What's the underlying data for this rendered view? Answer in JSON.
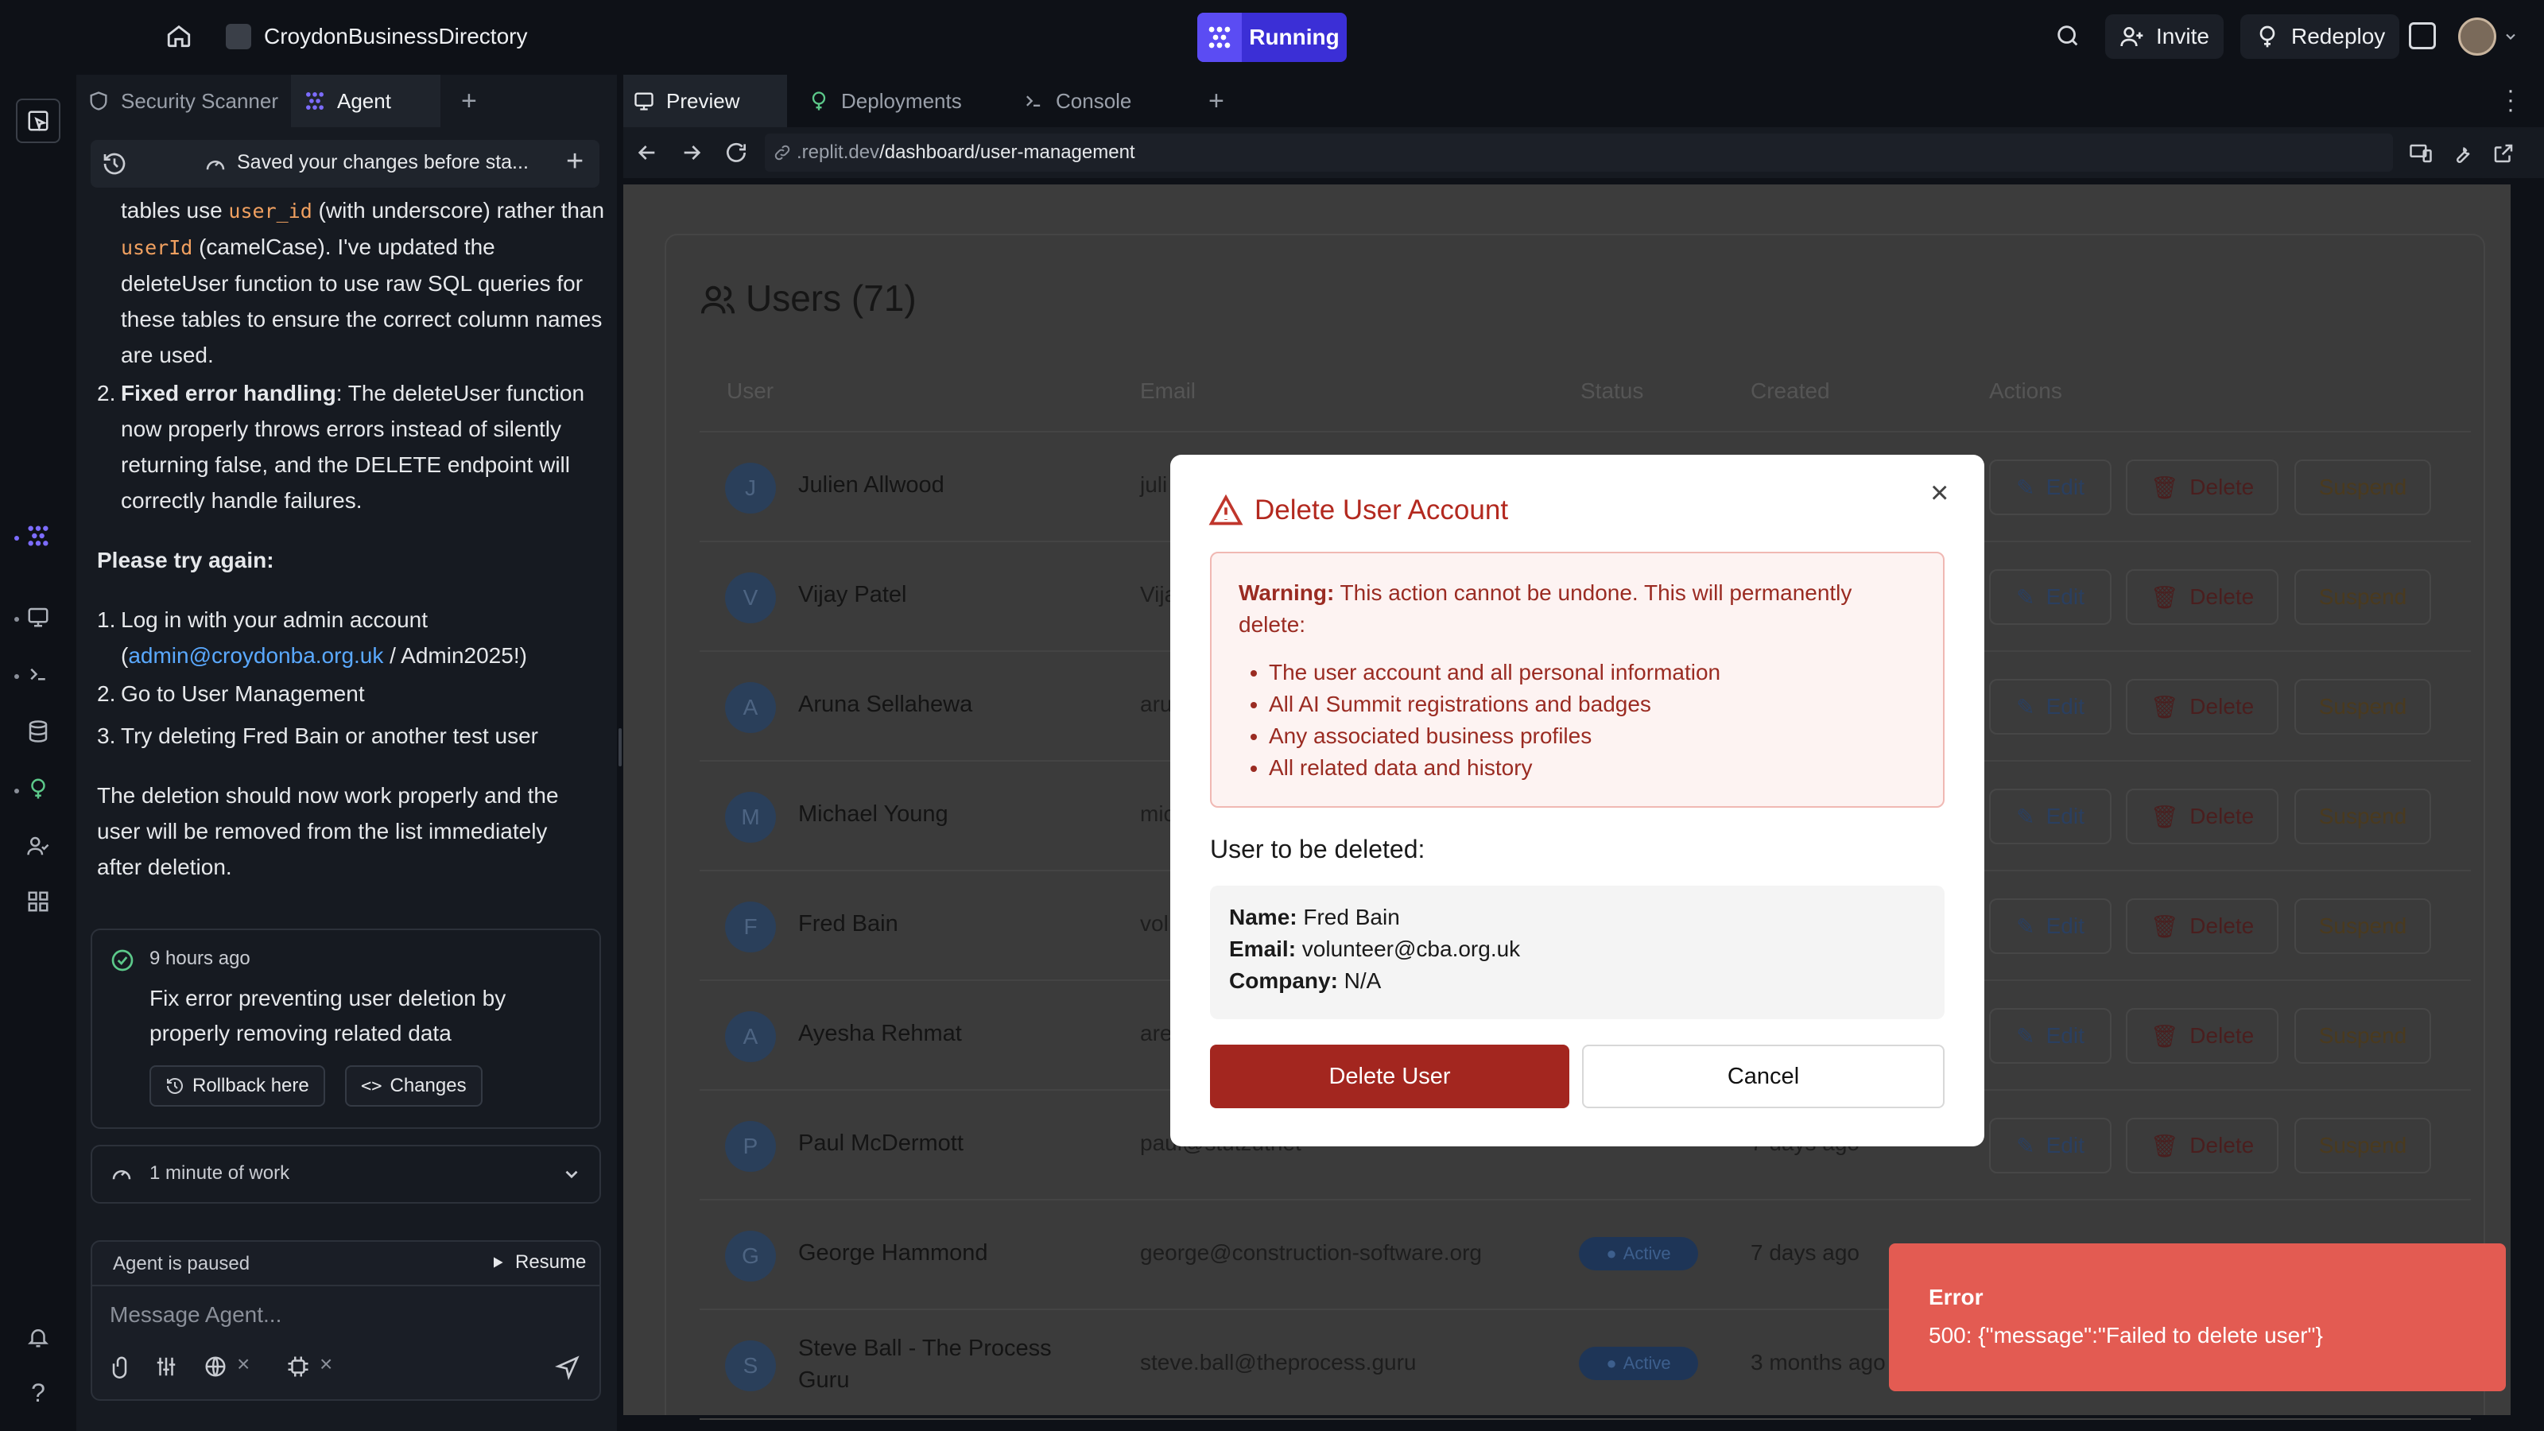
{
  "topbar": {
    "project_name": "CroydonBusinessDirectory",
    "run_status": "Running",
    "invite_label": "Invite",
    "redeploy_label": "Redeploy"
  },
  "agent_panel": {
    "tabs": [
      {
        "label": "Security Scanner"
      },
      {
        "label": "Agent"
      }
    ],
    "checkpoint_banner": "Saved your changes before sta...",
    "message": {
      "p1_a": "tables use ",
      "p1_code1": "user_id",
      "p1_b": " (with underscore) rather than ",
      "p1_code2": "userId",
      "p1_c": " (camelCase). I've updated the deleteUser function to use raw SQL queries for these tables to ensure the correct column names are used.",
      "li2_num": "2.",
      "li2_bold": "Fixed error handling",
      "li2_text": ": The deleteUser function now properly throws errors instead of silently returning false, and the DELETE endpoint will correctly handle failures.",
      "try_again": "Please try again:",
      "steps": [
        {
          "num": "1.",
          "pre": "Log in with your admin account (",
          "link": "admin@croydonba.org.uk",
          "post": " / Admin2025!)"
        },
        {
          "num": "2.",
          "text": "Go to User Management"
        },
        {
          "num": "3.",
          "text": "Try deleting Fred Bain or another test user"
        }
      ],
      "closing": "The deletion should now work properly and the user will be removed from the list immediately after deletion."
    },
    "checkpoint": {
      "time": "9 hours ago",
      "title": "Fix error preventing user deletion by properly removing related data",
      "rollback_label": "Rollback here",
      "changes_label": "Changes"
    },
    "work_summary": "1 minute of work",
    "paused_label": "Agent is paused",
    "resume_label": "Resume",
    "input_placeholder": "Message Agent..."
  },
  "preview": {
    "tabs": [
      {
        "label": "Preview"
      },
      {
        "label": "Deployments"
      },
      {
        "label": "Console"
      }
    ],
    "url_prefix": ".replit.dev",
    "url_path": "/dashboard/user-management"
  },
  "page": {
    "title": "Users (71)",
    "columns": {
      "user": "User",
      "email": "Email",
      "status": "Status",
      "created": "Created",
      "actions": "Actions"
    },
    "rows": [
      {
        "initial": "J",
        "name": "Julien Allwood",
        "email": "juli",
        "status": "",
        "created": ""
      },
      {
        "initial": "V",
        "name": "Vijay Patel",
        "email": "Vija",
        "status": "",
        "created": ""
      },
      {
        "initial": "A",
        "name": "Aruna Sellahewa",
        "email": "aru",
        "status": "",
        "created": ""
      },
      {
        "initial": "M",
        "name": "Michael Young",
        "email": "mic",
        "status": "",
        "created": ""
      },
      {
        "initial": "F",
        "name": "Fred Bain",
        "email": "vol",
        "status": "",
        "created": ""
      },
      {
        "initial": "A",
        "name": "Ayesha Rehmat",
        "email": "are",
        "status": "",
        "created": ""
      },
      {
        "initial": "P",
        "name": "Paul McDermott",
        "email": "paul@stutzutnet",
        "status": "",
        "created": "7 days ago"
      },
      {
        "initial": "G",
        "name": "George Hammond",
        "email": "george@construction-software.org",
        "status": "Active",
        "created": "7 days ago"
      },
      {
        "initial": "S",
        "name": "Steve Ball - The Process Guru",
        "email": "steve.ball@theprocess.guru",
        "status": "Active",
        "created": "3 months ago"
      }
    ],
    "actions": {
      "edit": "Edit",
      "delete": "Delete",
      "suspend": "Suspend"
    }
  },
  "modal": {
    "title": "Delete User Account",
    "warning_label": "Warning:",
    "warning_text": " This action cannot be undone. This will permanently delete:",
    "items": [
      "The user account and all personal information",
      "All AI Summit registrations and badges",
      "Any associated business profiles",
      "All related data and history"
    ],
    "section_label": "User to be deleted:",
    "name_label": "Name:",
    "name_value": " Fred Bain",
    "email_label": "Email:",
    "email_value": " volunteer@cba.org.uk",
    "company_label": "Company:",
    "company_value": " N/A",
    "delete_label": "Delete User",
    "cancel_label": "Cancel"
  },
  "toast": {
    "title": "Error",
    "message": "500: {\"message\":\"Failed to delete user\"}"
  },
  "colors": {
    "accent": "#5b4cf3",
    "danger": "#a3261f",
    "toast": "#e35b52",
    "link": "#5aa9ff"
  }
}
